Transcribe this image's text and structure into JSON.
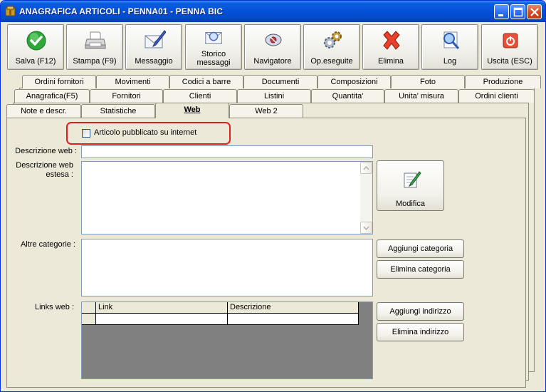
{
  "window": {
    "title": "ANAGRAFICA ARTICOLI - PENNA01 - PENNA BIC"
  },
  "toolbar": {
    "buttons": [
      {
        "label": "Salva (F12)",
        "icon": "check-icon"
      },
      {
        "label": "Stampa (F9)",
        "icon": "printer-icon"
      },
      {
        "label": "Messaggio",
        "icon": "envelope-pen-icon"
      },
      {
        "label": "Storico messaggi",
        "line1": "Storico",
        "line2": "messaggi",
        "icon": "envelope-search-icon"
      },
      {
        "label": "Navigatore",
        "icon": "navigator-icon"
      },
      {
        "label": "Op.eseguite",
        "icon": "gears-icon"
      },
      {
        "label": "Elimina",
        "icon": "delete-x-icon"
      },
      {
        "label": "Log",
        "icon": "log-search-icon"
      },
      {
        "label": "Uscita (ESC)",
        "icon": "power-icon"
      }
    ]
  },
  "tabs": {
    "row1": [
      "Ordini fornitori",
      "Movimenti",
      "Codici a barre",
      "Documenti",
      "Composizioni",
      "Foto",
      "Produzione"
    ],
    "row2": [
      "Anagrafica(F5)",
      "Fornitori",
      "Clienti",
      "Listini",
      "Quantita'",
      "Unita' misura",
      "Ordini clienti"
    ],
    "row3": [
      "Note e descr.",
      "Statistiche",
      "Web",
      "Web 2"
    ],
    "active": "Web"
  },
  "form": {
    "published_checkbox": {
      "label": "Articolo pubblicato su internet",
      "checked": false
    },
    "web_description": {
      "label": "Descrizione web :",
      "value": ""
    },
    "extended_description": {
      "label_line1": "Descrizione web",
      "label_line2": "estesa :",
      "value": ""
    },
    "edit_button": "Modifica",
    "other_categories": {
      "label": "Altre categorie :",
      "value": ""
    },
    "add_category_button": "Aggiungi categoria",
    "remove_category_button": "Elimina categoria",
    "links": {
      "label": "Links web :",
      "columns": [
        "Link",
        "Descrizione"
      ],
      "rows": [
        {
          "link": "",
          "descrizione": ""
        }
      ]
    },
    "add_address_button": "Aggiungi indirizzo",
    "remove_address_button": "Elimina indirizzo"
  },
  "colors": {
    "titlebar": "#0550d8",
    "highlight": "#e02020",
    "background": "#ece9d8"
  }
}
